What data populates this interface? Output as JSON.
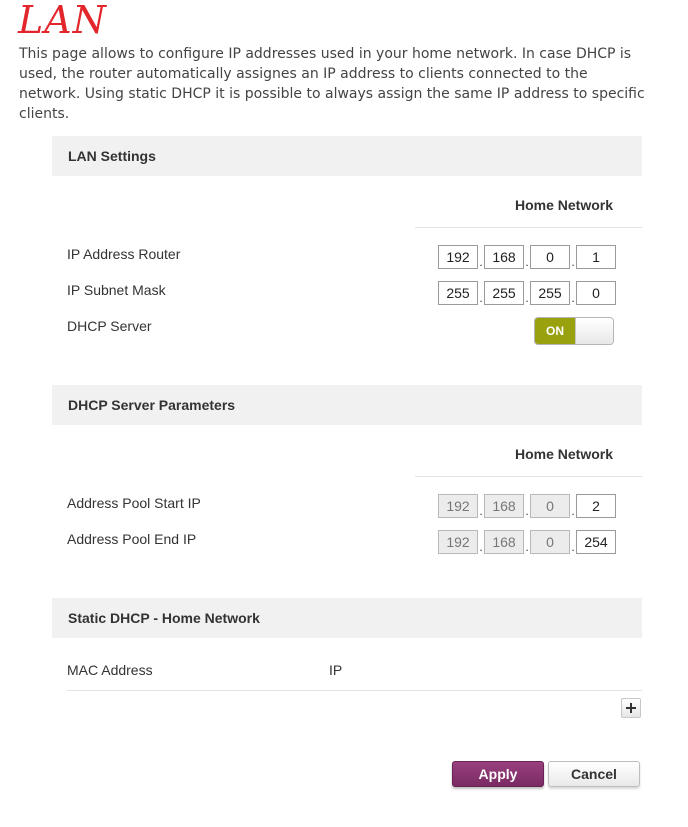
{
  "page": {
    "title": "LAN",
    "intro": "This page allows to configure IP addresses used in your home network. In case DHCP is used, the router automatically assignes an IP address to clients connected to the network. Using static DHCP it is possible to always assign the same IP address to specific clients."
  },
  "lan_settings": {
    "header": "LAN Settings",
    "column_header": "Home Network",
    "ip_router": {
      "label": "IP Address Router",
      "octets": [
        "192",
        "168",
        "0",
        "1"
      ]
    },
    "subnet_mask": {
      "label": "IP Subnet Mask",
      "octets": [
        "255",
        "255",
        "255",
        "0"
      ]
    },
    "dhcp_server": {
      "label": "DHCP Server",
      "state": "ON"
    }
  },
  "dhcp_params": {
    "header": "DHCP Server Parameters",
    "column_header": "Home Network",
    "pool_start": {
      "label": "Address Pool Start IP",
      "octets": [
        "192",
        "168",
        "0",
        "2"
      ]
    },
    "pool_end": {
      "label": "Address Pool End IP",
      "octets": [
        "192",
        "168",
        "0",
        "254"
      ]
    }
  },
  "static_dhcp": {
    "header": "Static DHCP - Home Network",
    "columns": [
      "MAC Address",
      "IP"
    ],
    "add_icon": "plus-icon"
  },
  "buttons": {
    "apply": "Apply",
    "cancel": "Cancel"
  },
  "colors": {
    "title": "#e2262c",
    "toggle_on": "#9aa10e",
    "apply": "#8a3573"
  }
}
